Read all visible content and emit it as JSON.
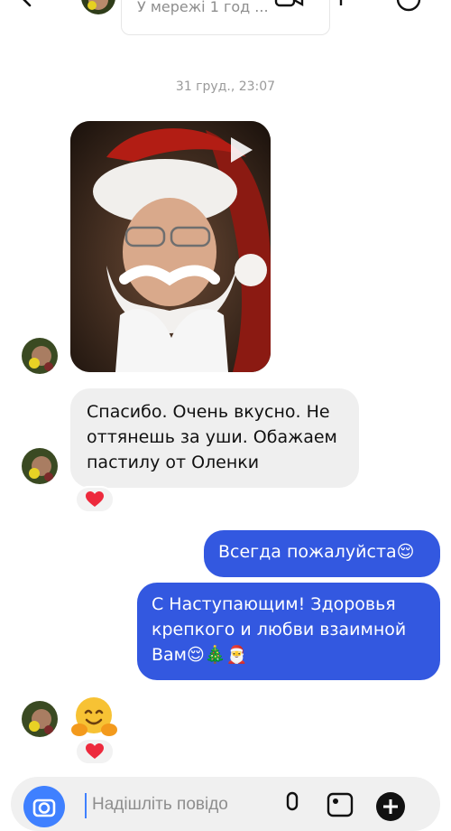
{
  "header": {
    "status": "У мережі 1 год ..."
  },
  "timestamp": "31 груд., 23:07",
  "messages": {
    "incoming_text": "Спасибо. Очень вкусно. Не оттянешь за уши. Обажаем пастилу от Оленки",
    "out1": "Всегда пожалуйста😌",
    "out2": "С Наступающим! Здоровья крепкого и любви взаимной Вам😌🎄🎅",
    "incoming_emoji": "🤗"
  },
  "reaction": "❤️",
  "composer": {
    "placeholder": "Надішліть повідо"
  },
  "colors": {
    "outgoing_bubble": "#3358e0",
    "incoming_bubble": "#efefef",
    "camera_button": "#3f80ff"
  }
}
